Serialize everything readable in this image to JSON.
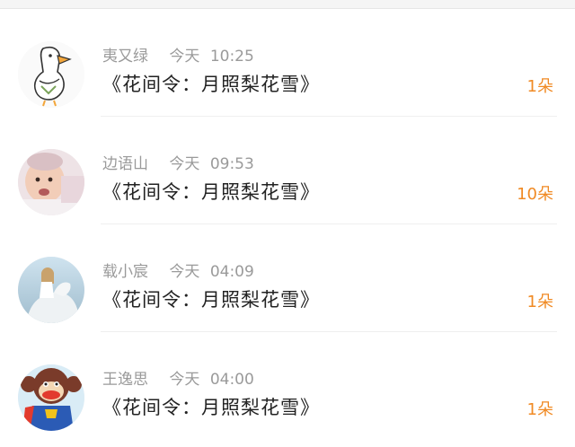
{
  "colors": {
    "accent": "#f08a24",
    "meta": "#9a9a9a",
    "title": "#222222"
  },
  "messages": [
    {
      "name": "夷又绿",
      "day": "今天",
      "time": "10:25",
      "title": "《花间令：月照梨花雪》",
      "count": "1朵",
      "avatar_icon": "white-goose-avatar"
    },
    {
      "name": "边语山",
      "day": "今天",
      "time": "09:53",
      "title": "《花间令：月照梨花雪》",
      "count": "10朵",
      "avatar_icon": "baby-photo-avatar"
    },
    {
      "name": "载小宸",
      "day": "今天",
      "time": "04:09",
      "title": "《花间令：月照梨花雪》",
      "count": "1朵",
      "avatar_icon": "rider-photo-avatar"
    },
    {
      "name": "王逸思",
      "day": "今天",
      "time": "04:00",
      "title": "《花间令：月照梨花雪》",
      "count": "1朵",
      "avatar_icon": "monkey-cartoon-avatar"
    }
  ]
}
